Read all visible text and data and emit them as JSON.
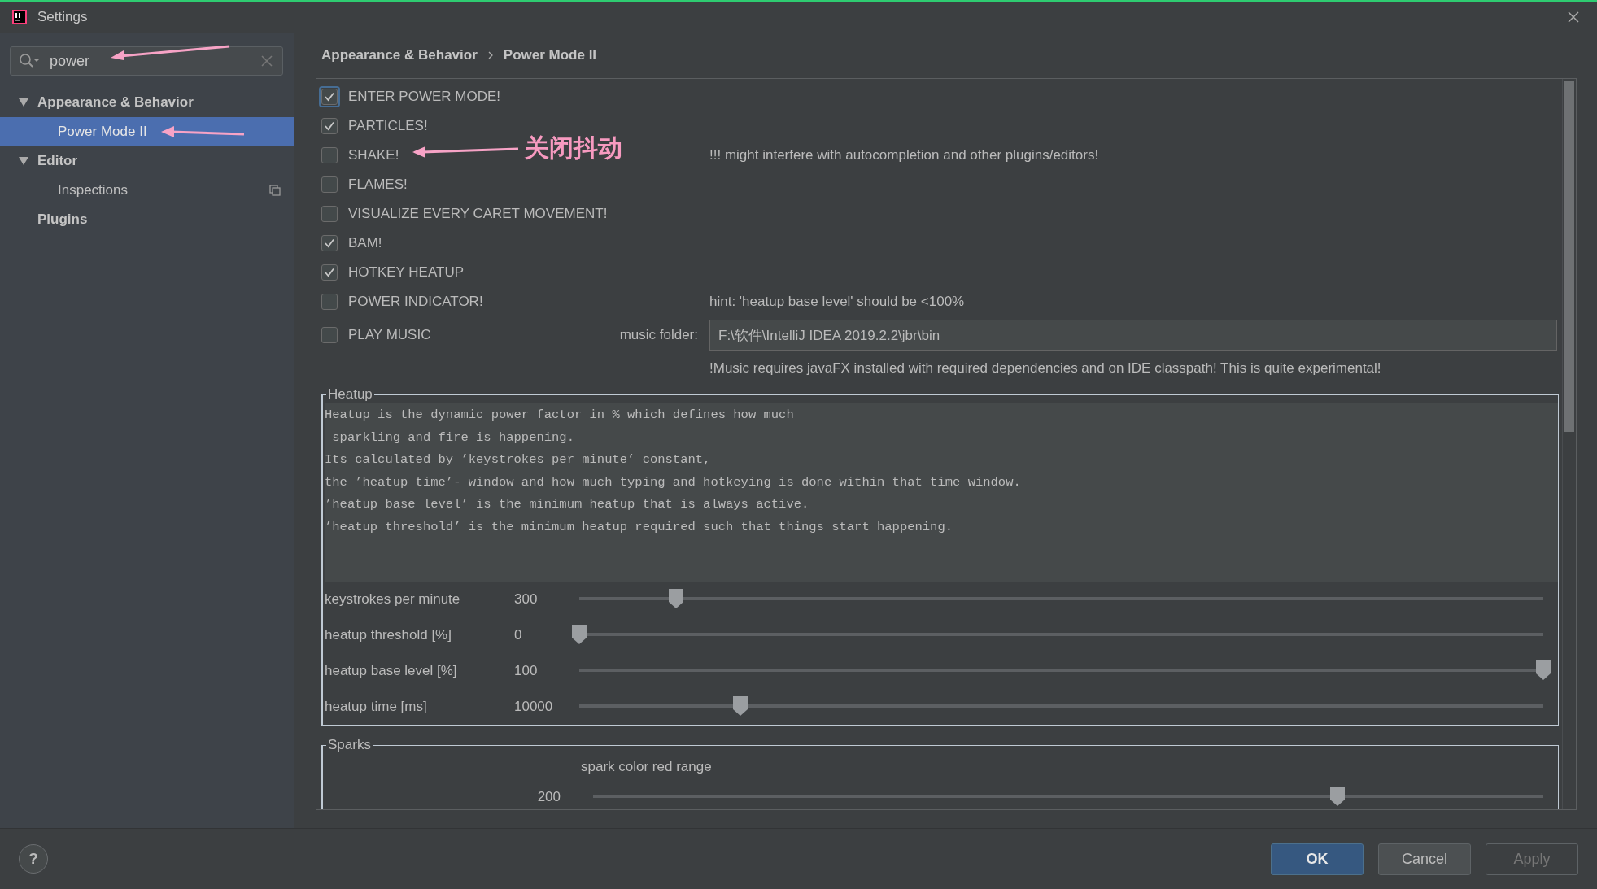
{
  "window": {
    "title": "Settings"
  },
  "search": {
    "value": "power"
  },
  "sidebar": {
    "items": [
      {
        "label": "Appearance & Behavior",
        "expanded": true,
        "selected": false,
        "children": [
          {
            "label": "Power Mode II",
            "selected": true
          }
        ]
      },
      {
        "label": "Editor",
        "expanded": true,
        "selected": false,
        "children": [
          {
            "label": "Inspections",
            "selected": false
          }
        ]
      },
      {
        "label": "Plugins",
        "selected": false
      }
    ]
  },
  "breadcrumb": [
    "Appearance & Behavior",
    "Power Mode II"
  ],
  "options": [
    {
      "label": "ENTER POWER MODE!",
      "checked": true,
      "focused": true
    },
    {
      "label": "PARTICLES!",
      "checked": true,
      "focused": false
    },
    {
      "label": "SHAKE!",
      "checked": false,
      "focused": false,
      "note": "!!! might interfere with autocompletion and other plugins/editors!"
    },
    {
      "label": "FLAMES!",
      "checked": false,
      "focused": false
    },
    {
      "label": "VISUALIZE EVERY CARET MOVEMENT!",
      "checked": false,
      "focused": false
    },
    {
      "label": "BAM!",
      "checked": true,
      "focused": false
    },
    {
      "label": "HOTKEY HEATUP",
      "checked": true,
      "focused": false
    },
    {
      "label": "POWER INDICATOR!",
      "checked": false,
      "focused": false,
      "note": "hint: 'heatup base level' should be <100%"
    },
    {
      "label": "PLAY MUSIC",
      "checked": false,
      "focused": false
    }
  ],
  "music": {
    "label": "music folder:",
    "value": "F:\\软件\\IntelliJ IDEA 2019.2.2\\jbr\\bin",
    "note": "!Music requires javaFX installed with required dependencies and on IDE classpath! This is quite experimental!"
  },
  "heatup": {
    "title": "Heatup",
    "description": [
      "Heatup is the dynamic power factor in % which defines how much",
      " sparkling and fire is happening.",
      "Its calculated by ’keystrokes per minute’ constant,",
      "the ’heatup time’- window and how much typing and hotkeying is done within that time window.",
      "’heatup base level’ is the minimum heatup that is always active.",
      "’heatup threshold’ is the minimum heatup required such that things start happening."
    ],
    "sliders": [
      {
        "label": "keystrokes per minute",
        "reading": "300",
        "level": 0.1
      },
      {
        "label": "heatup threshold [%]",
        "reading": "0",
        "level": 0
      },
      {
        "label": "heatup base level [%]",
        "reading": "100",
        "level": 1
      },
      {
        "label": "heatup time [ms]",
        "reading": "10000",
        "level": 0.167
      }
    ]
  },
  "sparks": {
    "title": "Sparks",
    "sliders": [
      {
        "label": "spark color red range",
        "reading": "200",
        "level": 0.783
      }
    ]
  },
  "annotation": {
    "text": "关闭抖动"
  },
  "help": {
    "label": "?"
  },
  "buttons": [
    {
      "label": "OK",
      "default": true,
      "disabled": false
    },
    {
      "label": "Cancel",
      "default": false,
      "disabled": false
    },
    {
      "label": "Apply",
      "default": false,
      "disabled": true
    }
  ]
}
